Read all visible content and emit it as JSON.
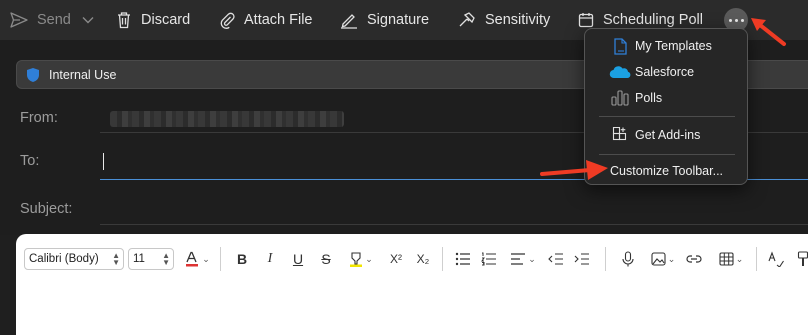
{
  "toolbar": {
    "send_label": "Send",
    "discard_label": "Discard",
    "attach_label": "Attach File",
    "signature_label": "Signature",
    "sensitivity_label": "Sensitivity",
    "poll_label": "Scheduling Poll"
  },
  "sensitivity_bar": {
    "label": "Internal Use"
  },
  "fields": {
    "from_label": "From:",
    "to_label": "To:",
    "subject_label": "Subject:",
    "to_value": "",
    "subject_value": ""
  },
  "formatting": {
    "font_family": "Calibri (Body)",
    "font_size": "11"
  },
  "more_menu": {
    "items": [
      {
        "label": "My Templates",
        "icon": "templates-icon"
      },
      {
        "label": "Salesforce",
        "icon": "salesforce-cloud-icon"
      },
      {
        "label": "Polls",
        "icon": "polls-icon"
      },
      {
        "label": "Get Add-ins",
        "icon": "add-ins-icon"
      },
      {
        "label": "Customize Toolbar...",
        "icon": ""
      }
    ]
  },
  "colors": {
    "annotation_arrow": "#ef3b24",
    "focus_underline": "#4a8fd6",
    "shield_blue": "#2f7fd8",
    "salesforce_blue": "#1ba0e2"
  }
}
